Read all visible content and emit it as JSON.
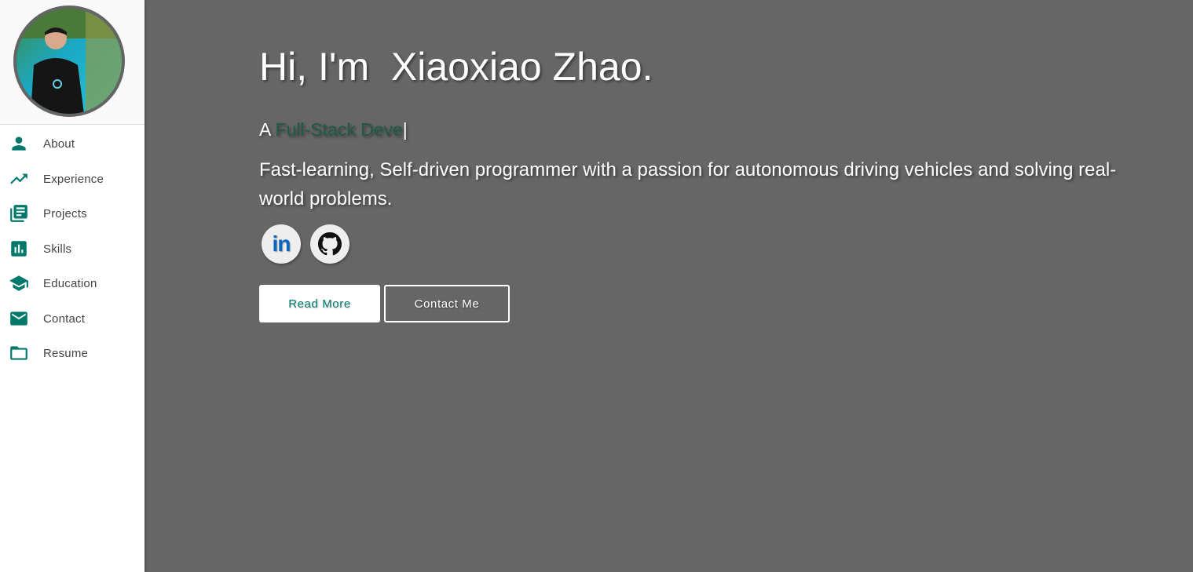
{
  "sidebar": {
    "avatar_alt": "profile photo",
    "items": [
      {
        "label": "About",
        "icon": "person-icon"
      },
      {
        "label": "Experience",
        "icon": "trending-up-icon"
      },
      {
        "label": "Projects",
        "icon": "library-books-icon"
      },
      {
        "label": "Skills",
        "icon": "bar-chart-icon"
      },
      {
        "label": "Education",
        "icon": "school-icon"
      },
      {
        "label": "Contact",
        "icon": "email-icon"
      },
      {
        "label": "Resume",
        "icon": "folder-icon"
      }
    ]
  },
  "hero": {
    "title": "Hi, I'm  Xiaoxiao Zhao.",
    "typed_prefix": "A ",
    "typed_role": "Full-Stack Deve",
    "typed_cursor": "|",
    "tagline": "Fast-learning, Self-driven programmer with a passion for autonomous driving vehicles and solving real-world problems."
  },
  "social": {
    "linkedin_text": "in",
    "linkedin_icon": "linkedin-icon",
    "github_icon": "github-icon"
  },
  "buttons": {
    "read_more": "Read More",
    "contact_me": "Contact Me"
  },
  "colors": {
    "accent": "#00796b",
    "main_bg": "#666666",
    "role_text": "#1f5a47",
    "linkedin_blue": "#0a66c2"
  }
}
